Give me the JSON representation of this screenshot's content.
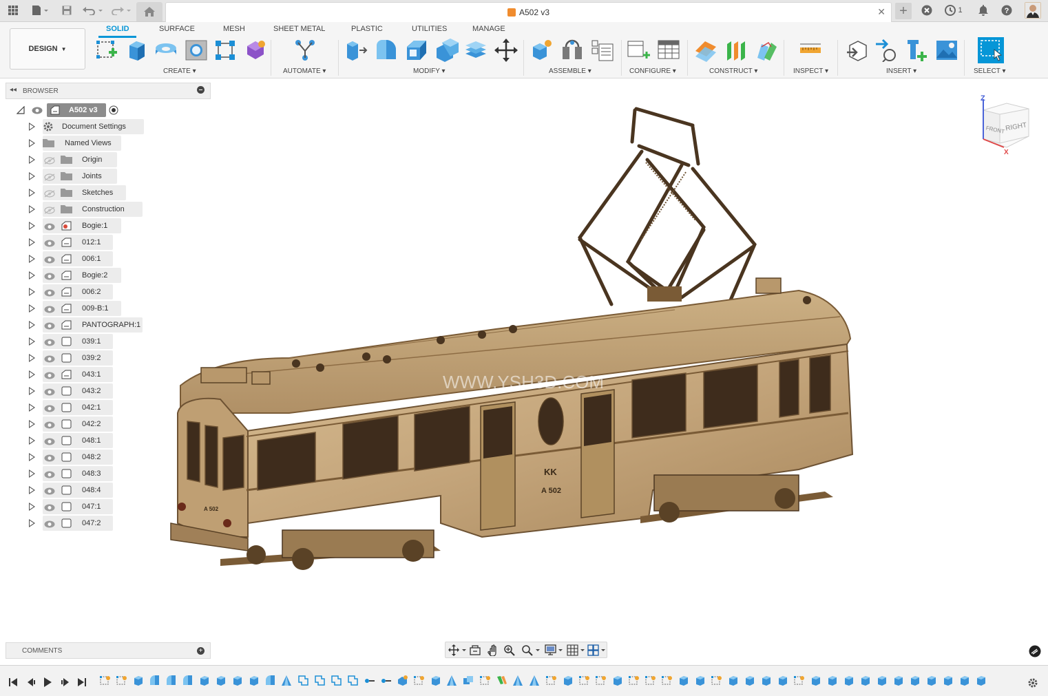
{
  "window": {
    "document_title": "A502 v3",
    "job_count": "1"
  },
  "ribbon": {
    "workspace_switcher": "DESIGN",
    "tabs": [
      "SOLID",
      "SURFACE",
      "MESH",
      "SHEET METAL",
      "PLASTIC",
      "UTILITIES",
      "MANAGE"
    ],
    "active_tab": "SOLID",
    "groups": {
      "create": "CREATE",
      "automate": "AUTOMATE",
      "modify": "MODIFY",
      "assemble": "ASSEMBLE",
      "configure": "CONFIGURE",
      "construct": "CONSTRUCT",
      "inspect": "INSPECT",
      "insert": "INSERT",
      "select": "SELECT"
    }
  },
  "browser": {
    "title": "BROWSER",
    "root": "A502 v3",
    "items": [
      {
        "label": "Document Settings",
        "icon": "gear-icon",
        "eye": "none"
      },
      {
        "label": "Named Views",
        "icon": "folder-icon",
        "eye": "none"
      },
      {
        "label": "Origin",
        "icon": "folder-icon",
        "eye": "hidden"
      },
      {
        "label": "Joints",
        "icon": "folder-icon",
        "eye": "hidden"
      },
      {
        "label": "Sketches",
        "icon": "folder-icon",
        "eye": "hidden"
      },
      {
        "label": "Construction",
        "icon": "folder-icon",
        "eye": "hidden"
      },
      {
        "label": "Bogie:1",
        "icon": "component-linked-icon",
        "eye": "visible"
      },
      {
        "label": "012:1",
        "icon": "component-icon",
        "eye": "visible"
      },
      {
        "label": "006:1",
        "icon": "component-icon",
        "eye": "visible"
      },
      {
        "label": "Bogie:2",
        "icon": "component-icon",
        "eye": "visible"
      },
      {
        "label": "006:2",
        "icon": "component-icon",
        "eye": "visible"
      },
      {
        "label": "009-B:1",
        "icon": "component-icon",
        "eye": "visible"
      },
      {
        "label": "PANTOGRAPH:1",
        "icon": "component-icon",
        "eye": "visible"
      },
      {
        "label": "039:1",
        "icon": "body-icon",
        "eye": "visible"
      },
      {
        "label": "039:2",
        "icon": "body-icon",
        "eye": "visible"
      },
      {
        "label": "043:1",
        "icon": "component-icon",
        "eye": "visible"
      },
      {
        "label": "043:2",
        "icon": "body-icon",
        "eye": "visible"
      },
      {
        "label": "042:1",
        "icon": "body-icon",
        "eye": "visible"
      },
      {
        "label": "042:2",
        "icon": "body-icon",
        "eye": "visible"
      },
      {
        "label": "048:1",
        "icon": "body-icon",
        "eye": "visible"
      },
      {
        "label": "048:2",
        "icon": "body-icon",
        "eye": "visible"
      },
      {
        "label": "048:3",
        "icon": "body-icon",
        "eye": "visible"
      },
      {
        "label": "048:4",
        "icon": "body-icon",
        "eye": "visible"
      },
      {
        "label": "047:1",
        "icon": "body-icon",
        "eye": "visible"
      },
      {
        "label": "047:2",
        "icon": "body-icon",
        "eye": "visible"
      }
    ]
  },
  "comments": {
    "title": "COMMENTS"
  },
  "viewcube": {
    "front": "FRONT",
    "right": "RIGHT",
    "axis_z": "Z",
    "axis_x": "X"
  },
  "model": {
    "car_letters": "KK",
    "car_number": "A 502",
    "end_number": "A 502",
    "watermark_text": "WWW.YSH3D.COM",
    "wood_color": "#c4a57b",
    "wood_dark": "#7a5b36",
    "window_color": "#3e2c1c"
  },
  "colors": {
    "accent": "#0696d7",
    "ribbon_bg": "#f5f5f5",
    "topbar_bg": "#e6e6e6"
  }
}
